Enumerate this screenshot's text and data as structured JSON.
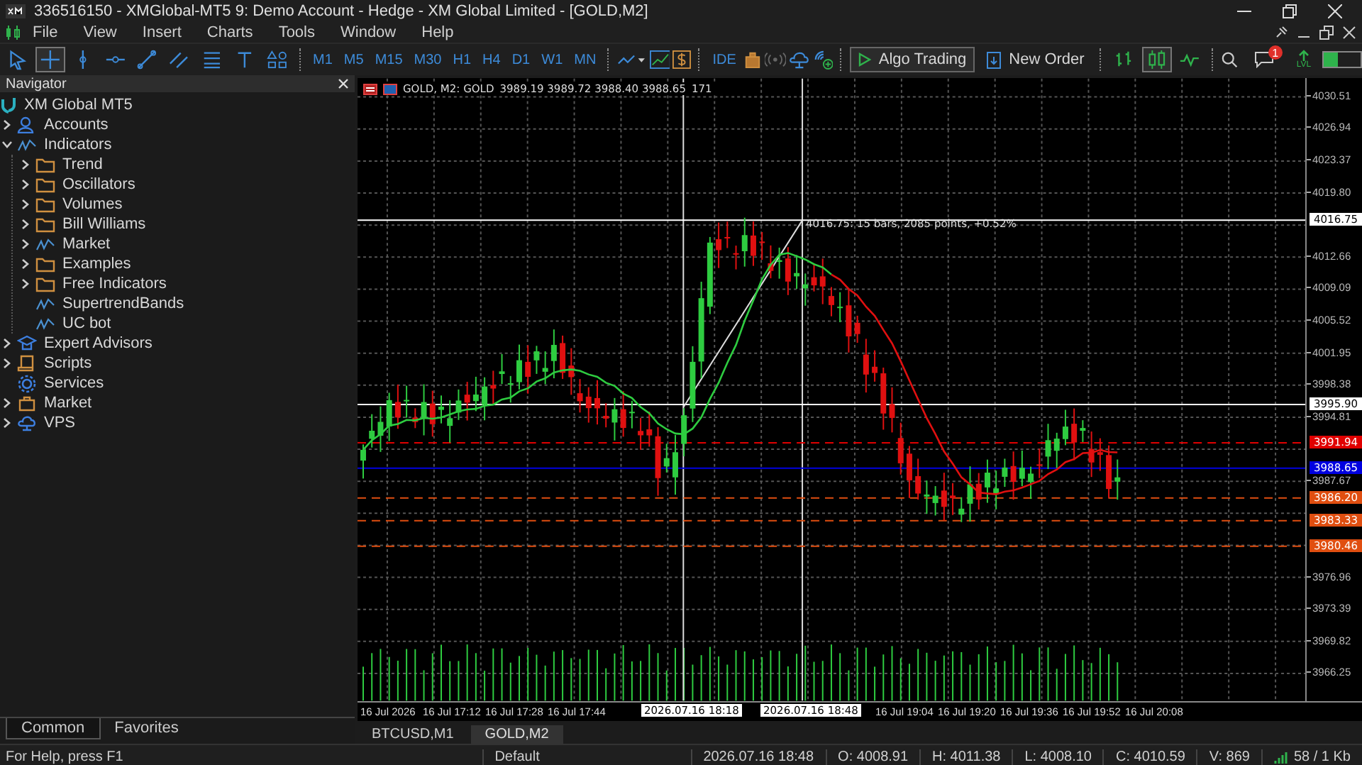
{
  "window": {
    "title": "336516150 - XMGlobal-MT5 9: Demo Account - Hedge - XM Global Limited - [GOLD,M2]"
  },
  "menu": [
    "File",
    "View",
    "Insert",
    "Charts",
    "Tools",
    "Window",
    "Help"
  ],
  "toolbar": {
    "drawing_tools": [
      {
        "selected": false
      },
      {
        "selected": true
      },
      {
        "selected": false
      },
      {
        "selected": false
      },
      {
        "selected": false
      },
      {
        "selected": false
      },
      {
        "selected": false
      },
      {
        "selected": false
      },
      {
        "selected": false
      }
    ],
    "timeframes": [
      "M1",
      "M5",
      "M15",
      "M30",
      "H1",
      "H4",
      "D1",
      "W1",
      "MN"
    ],
    "ide": "IDE",
    "algo_trading": "Algo Trading",
    "new_order": "New Order",
    "chart_types": [
      {
        "selected": false
      },
      {
        "selected": true
      },
      {
        "selected": false
      }
    ],
    "notification_badge": "1",
    "level_label": "LVL"
  },
  "navigator": {
    "title": "Navigator",
    "root": {
      "label": "XM Global MT5"
    },
    "items": [
      {
        "label": "Accounts",
        "kind": "account",
        "expanded": false
      },
      {
        "label": "Indicators",
        "kind": "indicator",
        "expanded": true,
        "children": [
          {
            "label": "Trend",
            "kind": "folder",
            "expanded": false
          },
          {
            "label": "Oscillators",
            "kind": "folder",
            "expanded": false
          },
          {
            "label": "Volumes",
            "kind": "folder",
            "expanded": false
          },
          {
            "label": "Bill Williams",
            "kind": "folder",
            "expanded": false
          },
          {
            "label": "Market",
            "kind": "indicator",
            "expanded": false
          },
          {
            "label": "Examples",
            "kind": "folder",
            "expanded": false
          },
          {
            "label": "Free Indicators",
            "kind": "folder",
            "expanded": false
          },
          {
            "label": "SupertrendBands",
            "kind": "indicator"
          },
          {
            "label": "UC bot",
            "kind": "indicator"
          }
        ]
      },
      {
        "label": "Expert Advisors",
        "kind": "expert",
        "expanded": false
      },
      {
        "label": "Scripts",
        "kind": "script",
        "expanded": false
      },
      {
        "label": "Services",
        "kind": "service"
      },
      {
        "label": "Market",
        "kind": "market",
        "expanded": false
      },
      {
        "label": "VPS",
        "kind": "vps",
        "expanded": false
      }
    ],
    "tabs": [
      {
        "label": "Common",
        "selected": true
      },
      {
        "label": "Favorites",
        "selected": false
      }
    ]
  },
  "chart": {
    "header": {
      "symbol": "GOLD, M2: GOLD",
      "quotes": "3989.19 3989.72 3988.40 3988.65",
      "volume": "171"
    },
    "measure_label": "4016.75: 15 bars, 2085 points, +0.52%",
    "price_axis": [
      {
        "label": "4030.51"
      },
      {
        "label": "4026.94"
      },
      {
        "label": "4023.37"
      },
      {
        "label": "4019.80"
      },
      {
        "covered": true
      },
      {
        "label": "4012.66"
      },
      {
        "label": "4009.09"
      },
      {
        "label": "4005.52"
      },
      {
        "label": "4001.95"
      },
      {
        "label": "3998.38"
      },
      {
        "label": "3994.81"
      },
      {
        "covered": true
      },
      {
        "label": "3987.67"
      },
      {
        "covered": true
      },
      {
        "covered": true
      },
      {
        "label": "3976.96"
      },
      {
        "label": "3973.39"
      },
      {
        "label": "3969.82"
      },
      {
        "label": "3966.25"
      }
    ],
    "price_markers": [
      {
        "label": "4016.75",
        "color": "#ffffff"
      },
      {
        "label": "3995.90",
        "color": "#ffffff"
      },
      {
        "label": "3991.94",
        "color": "#e00000"
      },
      {
        "label": "3988.65",
        "color": "#0000e0"
      },
      {
        "label": "3986.20",
        "color": "#e04e10"
      },
      {
        "label": "3983.33",
        "color": "#e04e10"
      },
      {
        "label": "3980.46",
        "color": "#e04e10"
      }
    ],
    "time_axis": [
      "16 Jul 2026",
      "16 Jul 17:12",
      "16 Jul 17:28",
      "16 Jul 17:44",
      "16 Jul 19:04",
      "16 Jul 19:20",
      "16 Jul 19:36",
      "16 Jul 19:52",
      "16 Jul 20:08"
    ],
    "crosshair_times": [
      "2026.07.16 18:18",
      "2026.07.16 18:48"
    ],
    "tabs": [
      {
        "label": "BTCUSD,M1",
        "selected": false
      },
      {
        "label": "GOLD,M2",
        "selected": true
      }
    ]
  },
  "status_bar": {
    "help": "For Help, press F1",
    "profile": "Default",
    "time": "2026.07.16 18:48",
    "open": "O: 4008.91",
    "high": "H: 4011.38",
    "low": "L: 4008.10",
    "close": "C: 4010.59",
    "volume": "V: 869",
    "traffic": "58 / 1 Kb"
  }
}
